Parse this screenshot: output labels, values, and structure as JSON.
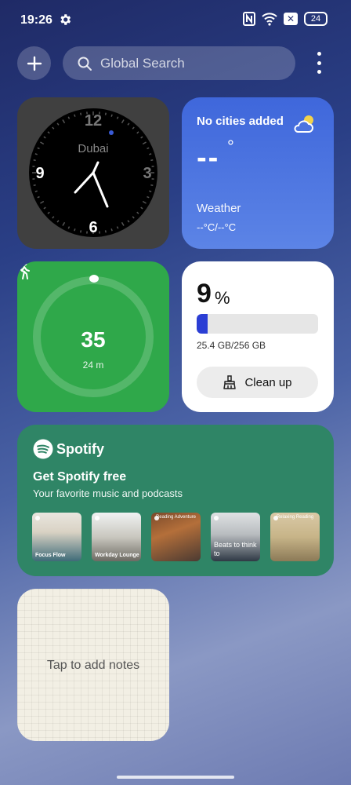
{
  "status_bar": {
    "time": "19:26",
    "battery": "24"
  },
  "search": {
    "placeholder": "Global Search"
  },
  "clock": {
    "city": "Dubai",
    "numerals": {
      "top": "12",
      "right": "3",
      "bottom": "6",
      "left": "9"
    }
  },
  "weather": {
    "title": "No cities added",
    "temp": "--",
    "degree": "°",
    "label": "Weather",
    "range": "--°C/--°C"
  },
  "steps": {
    "count": "35",
    "distance": "24 m"
  },
  "storage": {
    "percent": "9",
    "percent_symbol": "%",
    "used_fraction": 0.09,
    "size": "25.4 GB/256 GB",
    "button_label": "Clean up"
  },
  "spotify": {
    "brand": "Spotify",
    "title": "Get Spotify free",
    "subtitle": "Your favorite music and podcasts",
    "tiles": [
      {
        "caption": "Focus Flow"
      },
      {
        "caption": "Workday Lounge"
      },
      {
        "caption": "Reading Adventure"
      },
      {
        "caption": "Beats to think to"
      },
      {
        "caption": "Relaxing Reading"
      }
    ]
  },
  "notes": {
    "text": "Tap to add notes"
  },
  "colors": {
    "weather": "#3f67db",
    "steps": "#2fa84a",
    "spotify": "#2f8566",
    "storage_fill": "#2b3ed4"
  }
}
